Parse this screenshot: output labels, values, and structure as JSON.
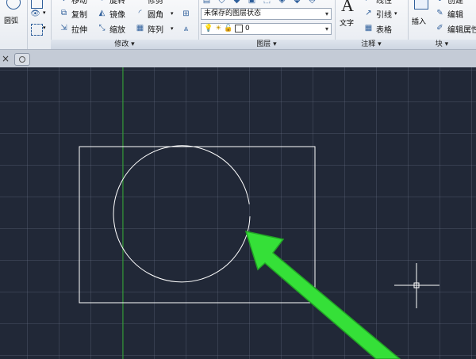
{
  "draw_panel": {
    "circle_label": "圆弧"
  },
  "modify_panel": {
    "title": "修改",
    "top_partial": [
      "移动",
      "旋转",
      "修剪"
    ],
    "row2": [
      "复制",
      "镜像",
      "圆角"
    ],
    "row3": [
      "拉伸",
      "缩放",
      "阵列"
    ]
  },
  "layers_panel": {
    "title": "图层",
    "state_combo": "未保存的图层状态",
    "layer_combo": "0"
  },
  "annotation_panel": {
    "title": "注释",
    "text_label": "文字",
    "top_partial": "线性",
    "leader": "引线",
    "table": "表格"
  },
  "block_panel": {
    "title": "块",
    "insert": "插入",
    "create_partial": "创建",
    "edit": "编辑",
    "edit_attrs": "编辑属性"
  },
  "colors": {
    "canvas": "#212837",
    "arrow": "#35e038",
    "geometry": "#ffffff",
    "y_axis": "#2aa52a"
  }
}
